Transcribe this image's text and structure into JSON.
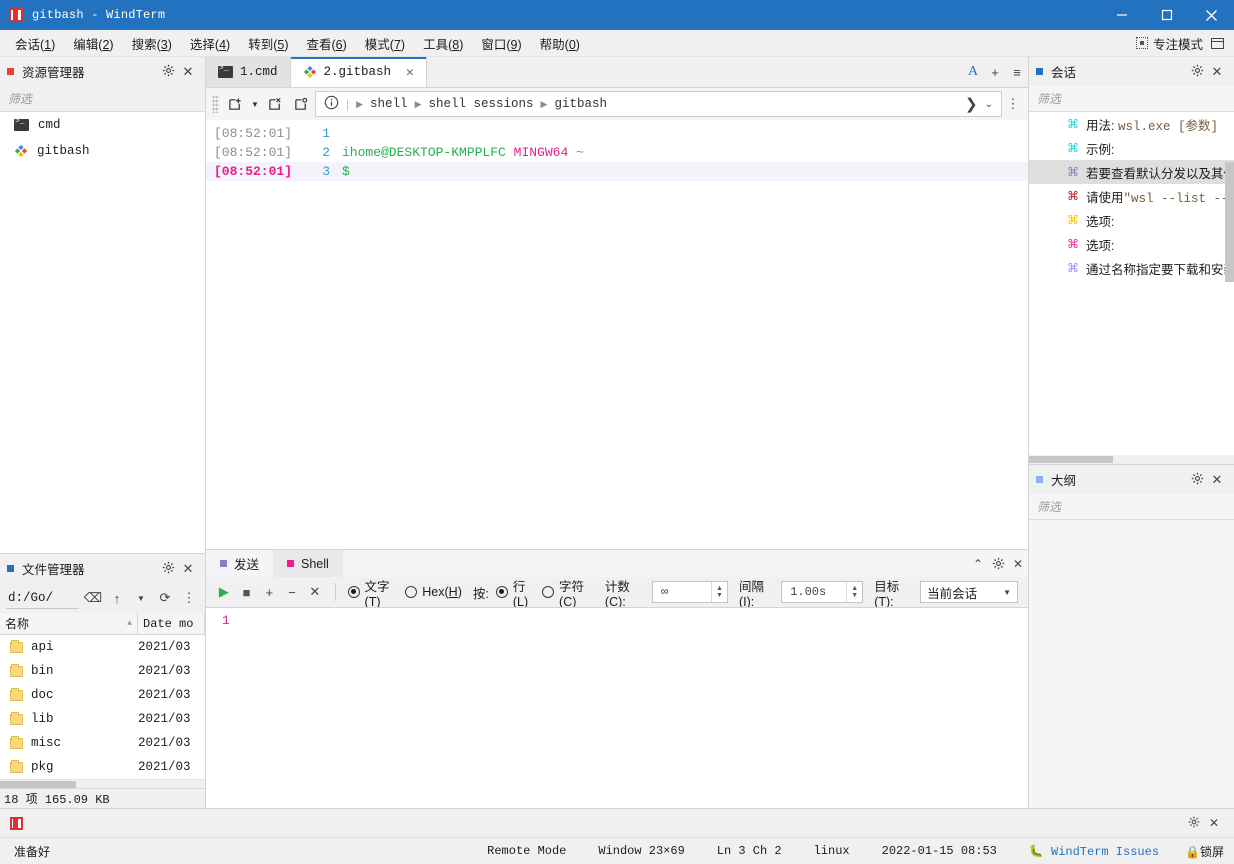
{
  "window": {
    "title": "gitbash - WindTerm",
    "logo_icon": "windterm-logo-icon",
    "minimize_label": "—",
    "maximize_label": "☐",
    "close_label": "✕"
  },
  "menubar": {
    "items": [
      {
        "text": "会话(1)",
        "label": "会话(",
        "key": "1",
        "tail": ")"
      },
      {
        "text": "编辑(2)",
        "label": "编辑(",
        "key": "2",
        "tail": ")"
      },
      {
        "text": "搜索(3)",
        "label": "搜索(",
        "key": "3",
        "tail": ")"
      },
      {
        "text": "选择(4)",
        "label": "选择(",
        "key": "4",
        "tail": ")"
      },
      {
        "text": "转到(5)",
        "label": "转到(",
        "key": "5",
        "tail": ")"
      },
      {
        "text": "查看(6)",
        "label": "查看(",
        "key": "6",
        "tail": ")"
      },
      {
        "text": "模式(7)",
        "label": "模式(",
        "key": "7",
        "tail": ")"
      },
      {
        "text": "工具(8)",
        "label": "工具(",
        "key": "8",
        "tail": ")"
      },
      {
        "text": "窗口(9)",
        "label": "窗口(",
        "key": "9",
        "tail": ")"
      },
      {
        "text": "帮助(0)",
        "label": "帮助(",
        "key": "0",
        "tail": ")"
      }
    ],
    "focus_mode": "专注模式"
  },
  "explorer": {
    "title": "资源管理器",
    "dot_color": "#e8413a",
    "filter_placeholder": "筛选",
    "items": [
      {
        "label": "cmd",
        "icon": "cmd-icon"
      },
      {
        "label": "gitbash",
        "icon": "gitbash-icon"
      }
    ]
  },
  "file_manager": {
    "title": "文件管理器",
    "dot_color": "#2372c0",
    "path": "d:/Go/",
    "columns": [
      "名称",
      "Date mo"
    ],
    "rows": [
      {
        "name": "api",
        "date": "2021/03"
      },
      {
        "name": "bin",
        "date": "2021/03"
      },
      {
        "name": "doc",
        "date": "2021/03"
      },
      {
        "name": "lib",
        "date": "2021/03"
      },
      {
        "name": "misc",
        "date": "2021/03"
      },
      {
        "name": "pkg",
        "date": "2021/03"
      }
    ],
    "status": "18 项 165.09 KB"
  },
  "tabs": {
    "items": [
      {
        "label": "1.cmd",
        "icon": "cmd-icon",
        "active": false,
        "closable": false
      },
      {
        "label": "2.gitbash",
        "icon": "gitbash-icon",
        "active": true,
        "closable": true
      }
    ],
    "font_button": "A",
    "add_button": "+",
    "menu_button": "≡"
  },
  "terminal_toolbar": {
    "new_tab_icon": "new-tab-icon",
    "close_tab_icon": "close-tab-icon",
    "restore_tab_icon": "restore-tab-icon",
    "info_icon": "info-icon",
    "breadcrumbs": [
      "shell",
      "shell sessions",
      "gitbash"
    ],
    "go_icon": "chevron-right-icon",
    "dropdown_icon": "chevron-down-icon",
    "more_icon": "more-vertical-icon"
  },
  "terminal": {
    "lines": [
      {
        "time": "[08:52:01]",
        "num": "1",
        "text": "",
        "current": false
      },
      {
        "time": "[08:52:01]",
        "num": "2",
        "host": "ihome@DESKTOP-KMPPLFC",
        "shell": "MINGW64",
        "path": "~",
        "current": false
      },
      {
        "time": "[08:52:01]",
        "num": "3",
        "prompt": "$",
        "current": true
      }
    ]
  },
  "send_panel": {
    "tabs": [
      {
        "label": "发送",
        "dot_color": "#8e7cc3",
        "active": false
      },
      {
        "label": "Shell",
        "dot_color": "#e91e8c",
        "active": true
      }
    ],
    "collapse_icon": "chevron-up-icon",
    "gear_icon": "gear-icon",
    "close_icon": "close-icon",
    "toolbar": {
      "play_icon": "play-icon",
      "stop_icon": "stop-icon",
      "add_icon": "plus-icon",
      "remove_icon": "minus-icon",
      "clear_icon": "close-icon",
      "mode_text": {
        "label": "文字(",
        "key": "T",
        "tail": ")",
        "selected": true
      },
      "mode_hex": {
        "label": "Hex(",
        "key": "H",
        "tail": ")",
        "selected": false
      },
      "by_label": "按:",
      "by_line": {
        "label": "行(",
        "key": "L",
        "tail": ")",
        "selected": true
      },
      "by_char": {
        "label": "字符(",
        "key": "C",
        "tail": ")",
        "selected": false
      },
      "count_label": "计数(C):",
      "count_value": "∞",
      "interval_label": "间隔(I):",
      "interval_value": "1.00s",
      "target_label": "目标(T):",
      "target_value": "当前会话"
    },
    "editor_line_number": "1"
  },
  "sessions": {
    "title": "会话",
    "dot_color": "#2372c0",
    "filter_placeholder": "筛选",
    "items": [
      {
        "icon_color": "#1fd0d8",
        "text": "用法: ",
        "mono": "wsl.exe [参数]",
        "selected": false
      },
      {
        "icon_color": "#1fd0d8",
        "text": "示例:",
        "mono": "",
        "selected": false
      },
      {
        "icon_color": "#8e7cc3",
        "text": "若要查看默认分发以及其他",
        "mono": "",
        "selected": true
      },
      {
        "icon_color": "#b32020",
        "text": "请使用",
        "mono": "\"wsl --list --o",
        "selected": false
      },
      {
        "icon_color": "#f2c200",
        "text": "选项:",
        "mono": "",
        "selected": false
      },
      {
        "icon_color": "#f0269a",
        "text": "选项:",
        "mono": "",
        "selected": false
      },
      {
        "icon_color": "#9b8cf0",
        "text": "通过名称指定要下载和安装",
        "mono": "",
        "selected": false
      }
    ]
  },
  "outline": {
    "title": "大纲",
    "dot_color": "#8ab4e8",
    "filter_placeholder": "筛选"
  },
  "statusbar": {
    "logo_icon": "windterm-logo-icon",
    "ready": "准备好",
    "cells": [
      "Remote Mode",
      "Window 23×69",
      "Ln 3  Ch 2",
      "linux",
      "2022-01-15 08:53"
    ],
    "issues_link": "WindTerm Issues",
    "lock_label": "锁屏",
    "gear_icon": "gear-icon",
    "close_icon": "close-icon"
  }
}
